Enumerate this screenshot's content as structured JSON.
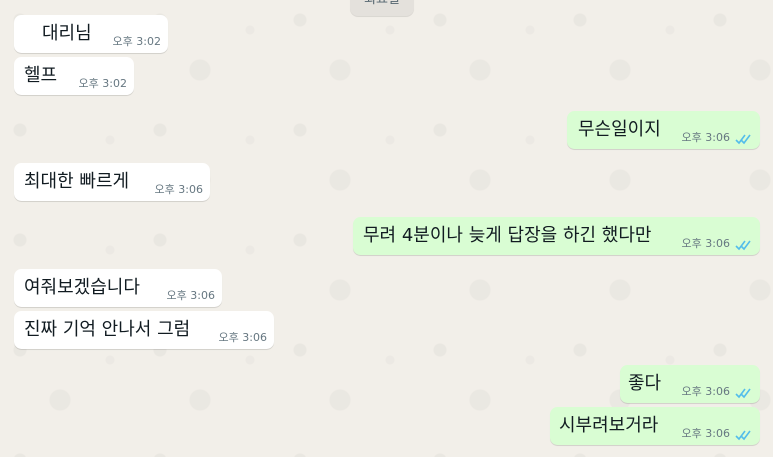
{
  "chat": {
    "date_chip": "회요일",
    "messages": [
      {
        "dir": "in",
        "text": "대리님",
        "time": "오후 3:02"
      },
      {
        "dir": "in",
        "text": "헬프",
        "time": "오후 3:02"
      },
      {
        "dir": "out",
        "text": "무슨일이지",
        "time": "오후 3:06",
        "status": "read"
      },
      {
        "dir": "in",
        "text": "최대한 빠르게",
        "time": "오후 3:06"
      },
      {
        "dir": "out",
        "text": "무려 4분이나 늦게 답장을 하긴 했다만",
        "time": "오후 3:06",
        "status": "read"
      },
      {
        "dir": "in",
        "text": "여줘보겠습니다",
        "time": "오후 3:06"
      },
      {
        "dir": "in",
        "text": "진짜 기억 안나서 그럼",
        "time": "오후 3:06"
      },
      {
        "dir": "out",
        "text": "좋다",
        "time": "오후 3:06",
        "status": "read"
      },
      {
        "dir": "out",
        "text": "시부려보거라",
        "time": "오후 3:06",
        "status": "read"
      }
    ]
  },
  "colors": {
    "incoming_bubble": "#ffffff",
    "outgoing_bubble": "#d9fdd3",
    "read_tick": "#53bdeb",
    "timestamp": "#667781"
  }
}
